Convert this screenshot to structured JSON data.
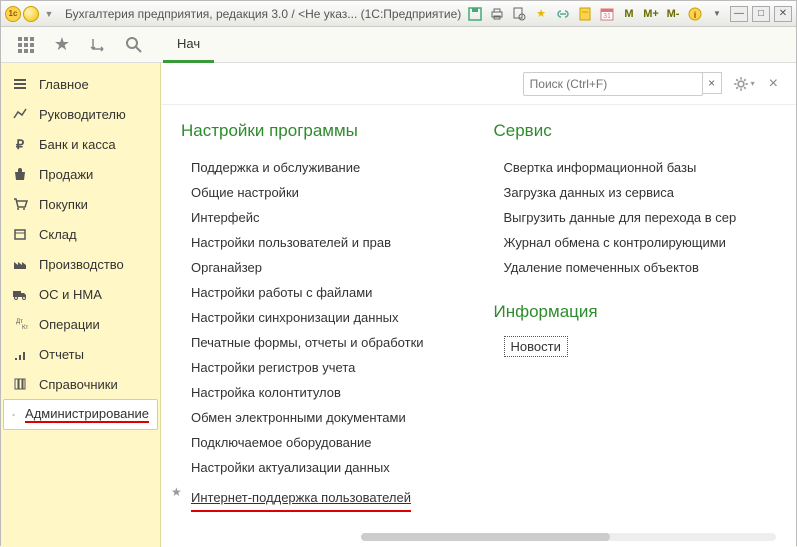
{
  "titlebar": {
    "text": "Бухгалтерия предприятия, редакция 3.0 / <Не указ...   (1С:Предприятие)",
    "m_buttons": [
      "M",
      "M+",
      "M-"
    ]
  },
  "toolbar": {
    "tab_label": "Нач"
  },
  "sidebar": {
    "items": [
      {
        "icon": "menu",
        "label": "Главное"
      },
      {
        "icon": "chart",
        "label": "Руководителю"
      },
      {
        "icon": "ruble",
        "label": "Банк и касса"
      },
      {
        "icon": "bag",
        "label": "Продажи"
      },
      {
        "icon": "cart",
        "label": "Покупки"
      },
      {
        "icon": "box",
        "label": "Склад"
      },
      {
        "icon": "factory",
        "label": "Производство"
      },
      {
        "icon": "truck",
        "label": "ОС и НМА"
      },
      {
        "icon": "ops",
        "label": "Операции"
      },
      {
        "icon": "report",
        "label": "Отчеты"
      },
      {
        "icon": "books",
        "label": "Справочники"
      },
      {
        "icon": "gear",
        "label": "Администрирование"
      }
    ]
  },
  "panel": {
    "search_placeholder": "Поиск (Ctrl+F)",
    "col1": {
      "heading": "Настройки программы",
      "links": [
        "Поддержка и обслуживание",
        "Общие настройки",
        "Интерфейс",
        "Настройки пользователей и прав",
        "Органайзер",
        "Настройки работы с файлами",
        "Настройки синхронизации данных",
        "Печатные формы, отчеты и обработки",
        "Настройки регистров учета",
        "Настройка колонтитулов",
        "Обмен электронными документами",
        "Подключаемое оборудование",
        "Настройки актуализации данных"
      ],
      "starred_link": "Интернет-поддержка пользователей"
    },
    "col2": {
      "heading1": "Сервис",
      "links1": [
        "Свертка информационной базы",
        "Загрузка данных из сервиса",
        "Выгрузить данные для перехода в сер",
        "Журнал обмена с контролирующими",
        "Удаление помеченных объектов"
      ],
      "heading2": "Информация",
      "boxed_link": "Новости"
    }
  }
}
